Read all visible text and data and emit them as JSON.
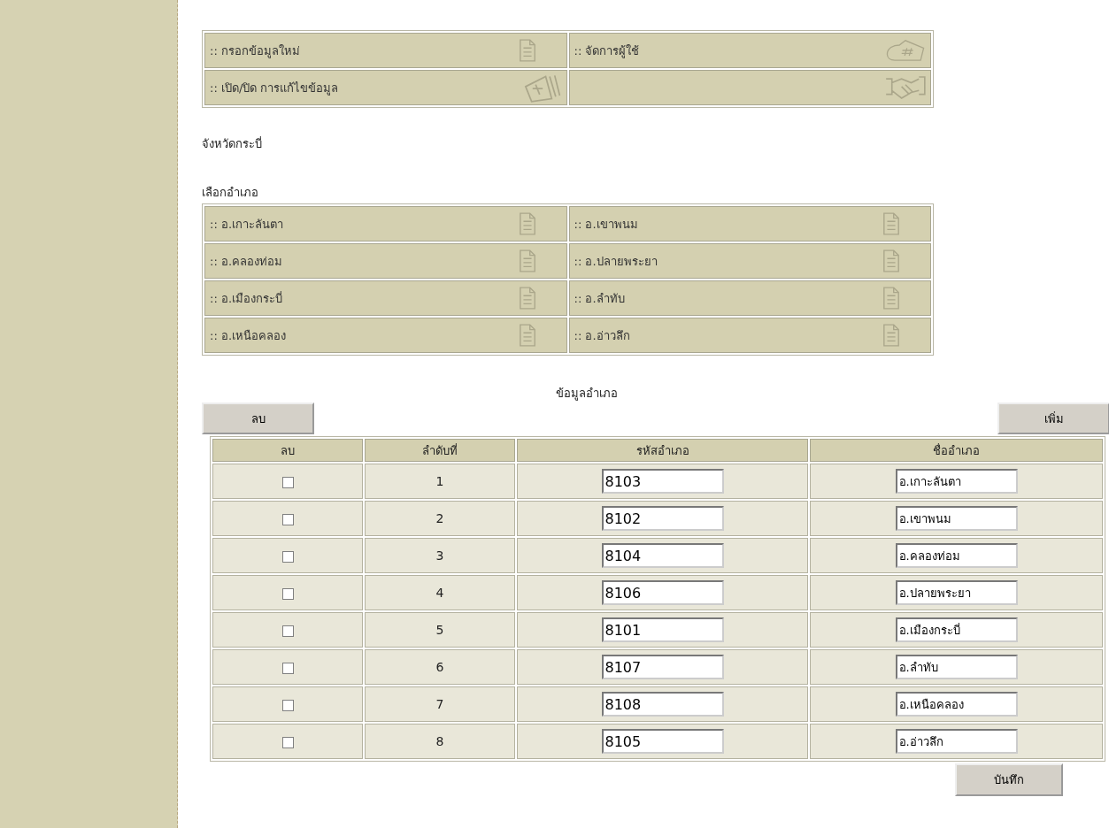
{
  "menu": [
    {
      "label": ":: กรอกข้อมูลใหม่"
    },
    {
      "label": ":: จัดการผู้ใช้"
    },
    {
      "label": ":: เปิด/ปิด การแก้ไขข้อมูล"
    }
  ],
  "province": "จังหวัดกระบี่",
  "district_picker": {
    "title": "เลือกอำเภอ",
    "items": [
      ":: อ.เกาะลันตา",
      ":: อ.เขาพนม",
      ":: อ.คลองท่อม",
      ":: อ.ปลายพระยา",
      ":: อ.เมืองกระบี่",
      ":: อ.ลำทับ",
      ":: อ.เหนือคลอง",
      ":: อ.อ่าวลึก"
    ]
  },
  "table_title": "ข้อมูลอำเภอ",
  "delete_button": "ลบ",
  "add_button": "เพิ่ม",
  "table": {
    "columns": [
      "ลบ",
      "ลำดับที่",
      "รหัสอำเภอ",
      "ชื่ออำเภอ"
    ],
    "rows": [
      {
        "checked": false,
        "no": "1",
        "code": "8103",
        "name": "อ.เกาะลันตา"
      },
      {
        "checked": false,
        "no": "2",
        "code": "8102",
        "name": "อ.เขาพนม"
      },
      {
        "checked": false,
        "no": "3",
        "code": "8104",
        "name": "อ.คลองท่อม"
      },
      {
        "checked": false,
        "no": "4",
        "code": "8106",
        "name": "อ.ปลายพระยา"
      },
      {
        "checked": false,
        "no": "5",
        "code": "8101",
        "name": "อ.เมืองกระบี่"
      },
      {
        "checked": false,
        "no": "6",
        "code": "8107",
        "name": "อ.ลำทับ"
      },
      {
        "checked": false,
        "no": "7",
        "code": "8108",
        "name": "อ.เหนือคลอง"
      },
      {
        "checked": false,
        "no": "8",
        "code": "8105",
        "name": "อ.อ่าวลึก"
      }
    ]
  },
  "save_button": "บันทึก"
}
